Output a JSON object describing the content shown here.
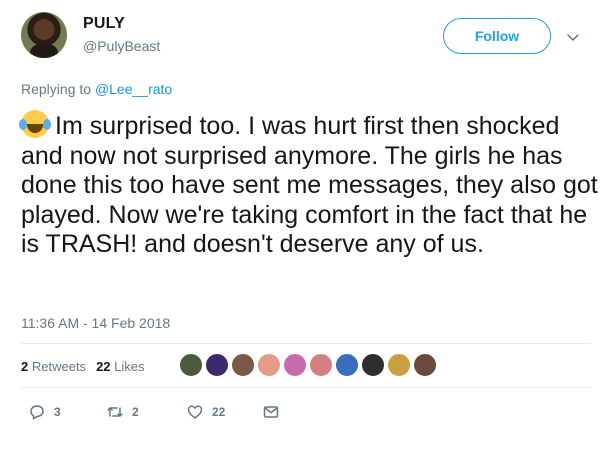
{
  "user": {
    "display_name": "PULY",
    "handle": "@PulyBeast"
  },
  "follow_label": "Follow",
  "reply": {
    "prefix": "Replying to",
    "mention": "@Lee__rato"
  },
  "tweet": {
    "emoji": "😂",
    "text": "Im surprised too. I was hurt first then shocked and now not surprised anymore. The girls he has done this too have sent me messages, they also got played. Now we're taking comfort in the fact that he is TRASH! and doesn't deserve any of us."
  },
  "timestamp": "11:36 AM - 14 Feb 2018",
  "stats": {
    "retweets_count": "2",
    "retweets_label": "Retweets",
    "likes_count": "22",
    "likes_label": "Likes"
  },
  "liker_colors": [
    "#4a5a3a",
    "#3b2b6a",
    "#7a5a46",
    "#e59a8a",
    "#c86ab0",
    "#d48080",
    "#3a6cc0",
    "#2e2e2e",
    "#c8a040",
    "#6a4a3a"
  ],
  "actions": {
    "reply_count": "3",
    "retweet_count": "2",
    "like_count": "22"
  },
  "colors": {
    "accent": "#1da1f2",
    "secondary_text": "#657786",
    "primary_text": "#14171a"
  }
}
